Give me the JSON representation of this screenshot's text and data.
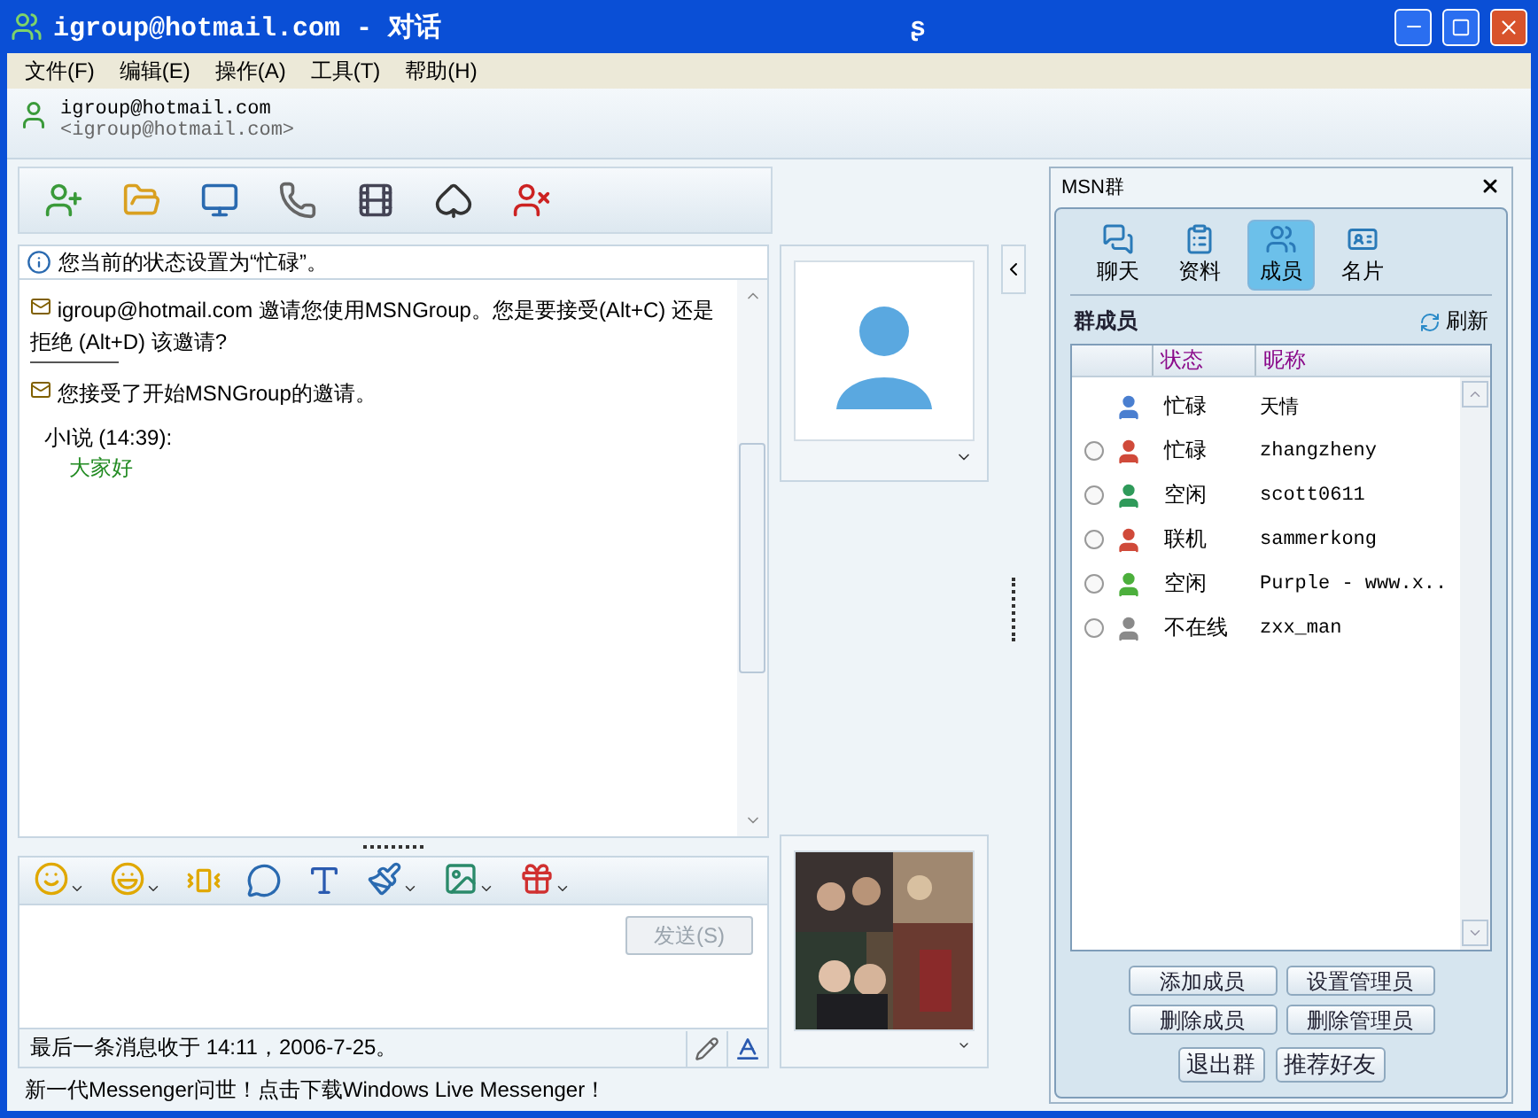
{
  "window": {
    "title": "igroup@hotmail.com - 对话",
    "title_glyph": "ʂ"
  },
  "menu": [
    "文件(F)",
    "编辑(E)",
    "操作(A)",
    "工具(T)",
    "帮助(H)"
  ],
  "contact": {
    "name": "igroup@hotmail.com",
    "address": "<igroup@hotmail.com>"
  },
  "chat": {
    "status_notice": "您当前的状态设置为“忙碌”。",
    "messages": [
      {
        "kind": "invite",
        "sender": "igroup@hotmail.com",
        "text": "邀请您使用MSNGroup。您是要接受(Alt+C) 还是拒绝 (Alt+D) 该邀请?"
      },
      {
        "kind": "notice",
        "text": "您接受了开始MSNGroup的邀请。"
      },
      {
        "kind": "chat",
        "speaker": "小I说 (14:39):",
        "text": "大家好"
      }
    ]
  },
  "compose": {
    "send_button": {
      "label": "发送(S)",
      "disabled": true
    },
    "last_message": "最后一条消息收于 14:11，2006-7-25。"
  },
  "footer": "新一代Messenger问世！点击下载Windows Live Messenger！",
  "group_panel": {
    "title": "MSN群",
    "tabs": [
      {
        "label": "聊天",
        "selected": false
      },
      {
        "label": "资料",
        "selected": false
      },
      {
        "label": "成员",
        "selected": true
      },
      {
        "label": "名片",
        "selected": false
      }
    ],
    "section_title": "群成员",
    "refresh": "刷新",
    "columns": [
      "状态",
      "昵称"
    ],
    "members": [
      {
        "kind": "self",
        "status": "忙碌",
        "nickname": "天情",
        "color": "#4a7fd0"
      },
      {
        "kind": "member",
        "selected": false,
        "status": "忙碌",
        "nickname": "zhangzheny",
        "color": "#d04a3a"
      },
      {
        "kind": "member",
        "selected": false,
        "status": "空闲",
        "nickname": "scott0611",
        "color": "#2f9a5a"
      },
      {
        "kind": "member",
        "selected": false,
        "status": "联机",
        "nickname": "sammerkong",
        "color": "#d04a3a"
      },
      {
        "kind": "member",
        "selected": false,
        "status": "空闲",
        "nickname": "Purple - www.x..",
        "color": "#4caf3c"
      },
      {
        "kind": "member",
        "selected": false,
        "status": "不在线",
        "nickname": "zxx_man",
        "color": "#8a8a8a"
      }
    ],
    "buttons": [
      "添加成员",
      "设置管理员",
      "删除成员",
      "删除管理员",
      "退出群",
      "推荐好友"
    ]
  }
}
